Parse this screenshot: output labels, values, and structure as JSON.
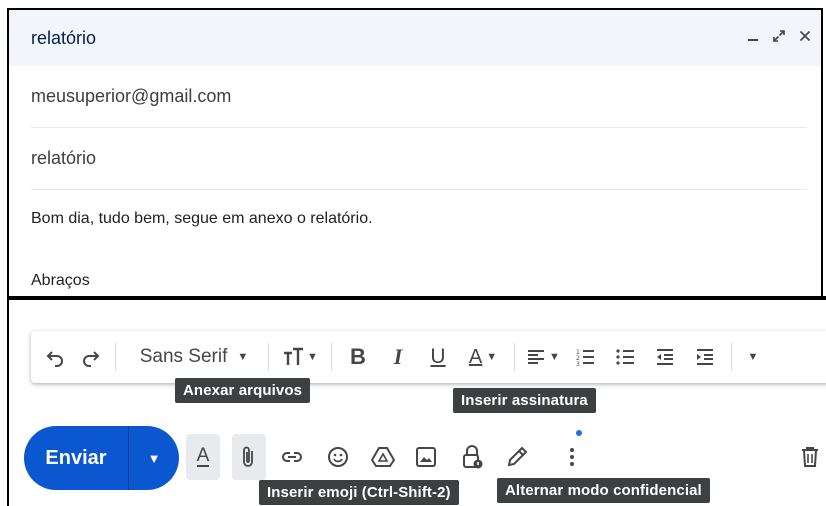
{
  "compose": {
    "title": "relatório",
    "to": "meusuperior@gmail.com",
    "subject": "relatório",
    "body_line1": "Bom dia, tudo bem, segue em anexo o relatório.",
    "body_line2": "Abraços"
  },
  "toolbar": {
    "font_family": "Sans Serif",
    "bold_glyph": "B",
    "italic_glyph": "I",
    "underline_glyph": "U",
    "text_color_glyph": "A"
  },
  "send": {
    "label": "Enviar"
  },
  "tooltips": {
    "attach": "Anexar arquivos",
    "signature": "Inserir assinatura",
    "emoji": "Inserir emoji (Ctrl-Shift-2)",
    "confidential": "Alternar modo confidencial"
  },
  "bottom_bar": {
    "formatting_glyph": "A"
  },
  "colors": {
    "send_button": "#0b57d0",
    "title_bar": "#f2f6fc",
    "tooltip": "#3c4043",
    "badge": "#1a73e8"
  },
  "icons": [
    "minimize-icon",
    "expand-icon",
    "close-icon",
    "undo-icon",
    "redo-icon",
    "text-size-icon",
    "align-icon",
    "numbered-list-icon",
    "bulleted-list-icon",
    "indent-less-icon",
    "indent-more-icon",
    "more-formatting-icon",
    "attach-icon",
    "link-icon",
    "emoji-icon",
    "drive-icon",
    "photo-icon",
    "confidential-icon",
    "signature-icon",
    "more-options-icon",
    "trash-icon"
  ]
}
